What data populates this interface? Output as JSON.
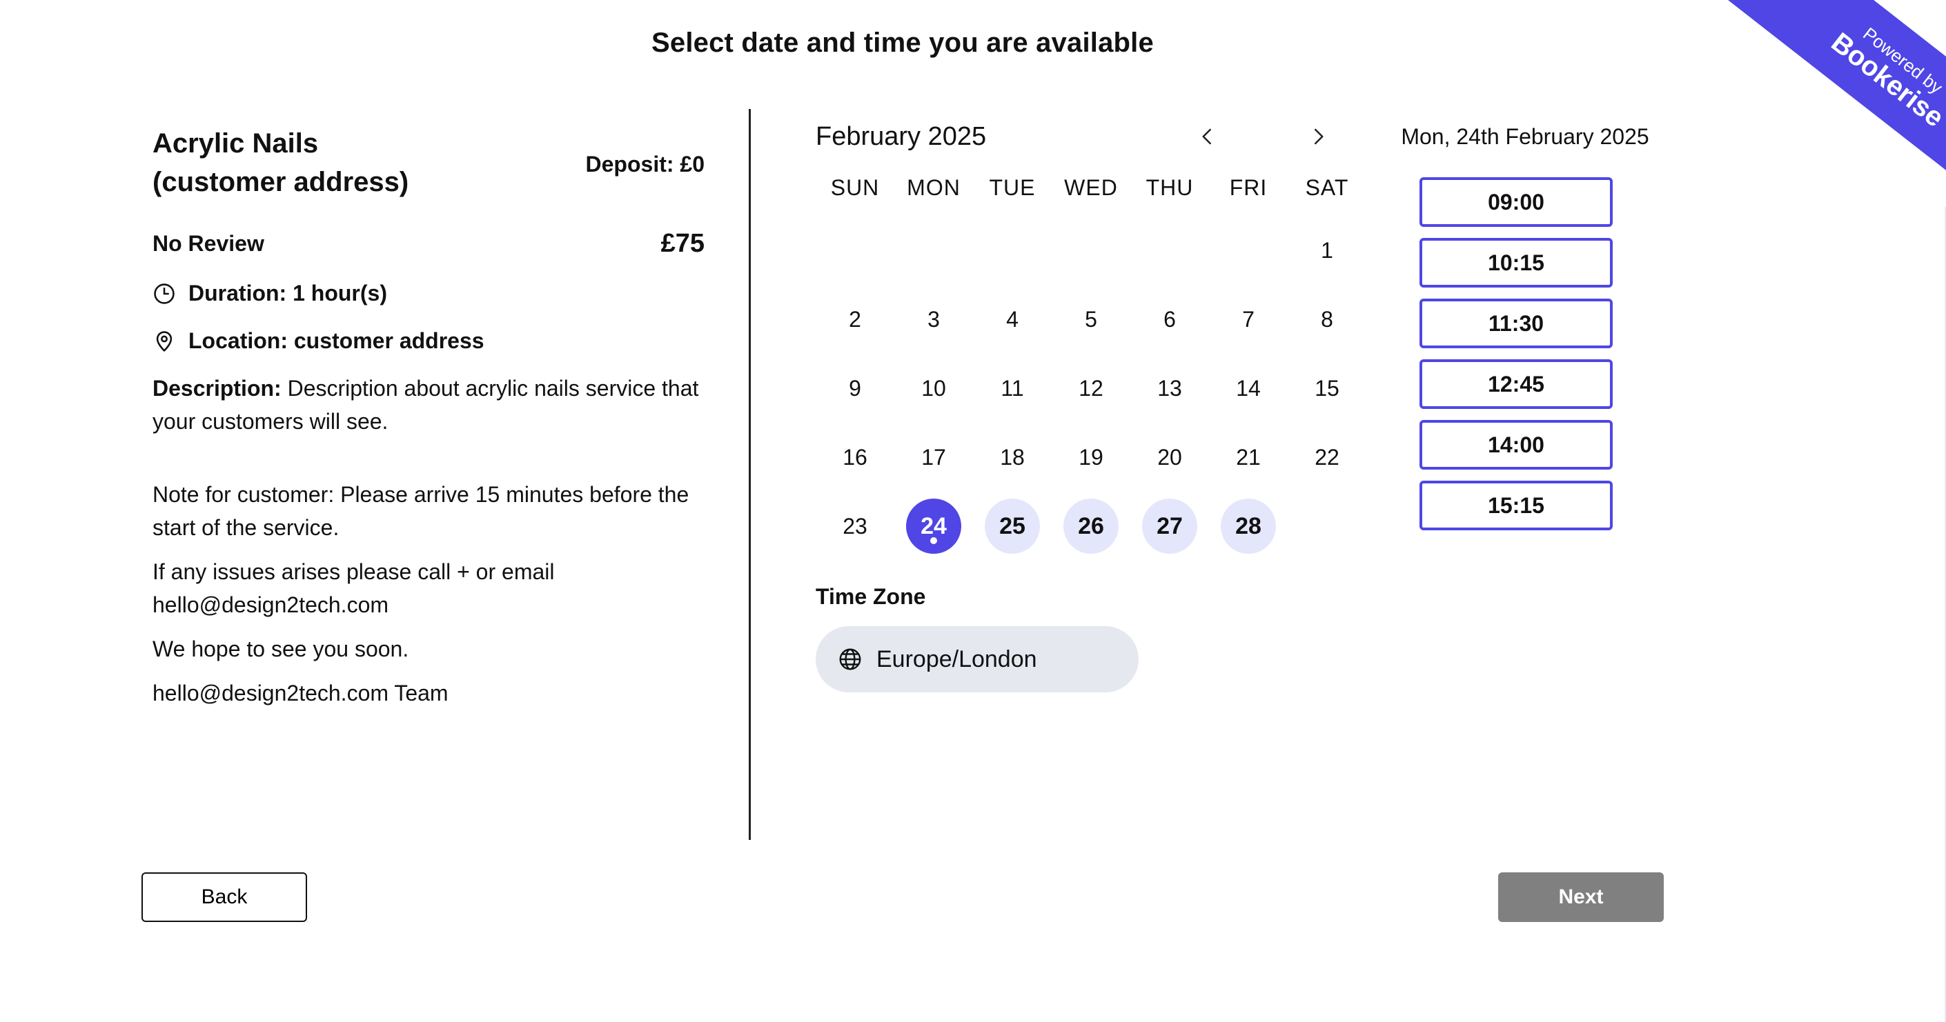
{
  "page": {
    "title": "Select date and time you are available"
  },
  "ribbon": {
    "powered_by": "Powered by",
    "brand": "Bookerise",
    "color": "#4f46e5"
  },
  "service": {
    "name_line1": "Acrylic Nails",
    "name_line2": "(customer address)",
    "deposit": "Deposit: £0",
    "review": "No Review",
    "price": "£75",
    "duration": "Duration: 1 hour(s)",
    "location": "Location: customer address",
    "description_label": "Description:",
    "description_text": " Description about acrylic nails service that your customers will see.",
    "note_lines": [
      "Note for customer: Please arrive 15 minutes before the start of the service.",
      "If any issues arises please call + or email hello@design2tech.com",
      "We hope to see you soon.",
      "hello@design2tech.com Team"
    ]
  },
  "calendar": {
    "month": "February 2025",
    "prev_icon": "chevron-left-icon",
    "next_icon": "chevron-right-icon",
    "weekdays": [
      "SUN",
      "MON",
      "TUE",
      "WED",
      "THU",
      "FRI",
      "SAT"
    ],
    "leading_blanks": 6,
    "days": [
      "1",
      "2",
      "3",
      "4",
      "5",
      "6",
      "7",
      "8",
      "9",
      "10",
      "11",
      "12",
      "13",
      "14",
      "15",
      "16",
      "17",
      "18",
      "19",
      "20",
      "21",
      "22",
      "23",
      "24",
      "25",
      "26",
      "27",
      "28"
    ],
    "available": [
      "24",
      "25",
      "26",
      "27",
      "28"
    ],
    "selected": "24"
  },
  "timezone": {
    "label": "Time Zone",
    "value": "Europe/London",
    "icon": "globe-icon"
  },
  "times": {
    "selected_date": "Mon, 24th February 2025",
    "slots": [
      "09:00",
      "10:15",
      "11:30",
      "12:45",
      "14:00",
      "15:15"
    ]
  },
  "buttons": {
    "back": "Back",
    "next": "Next"
  }
}
